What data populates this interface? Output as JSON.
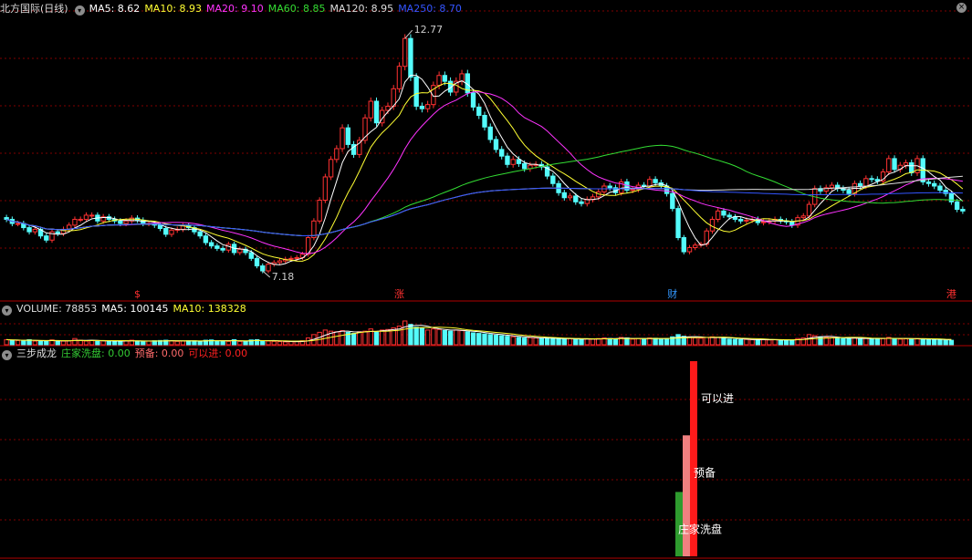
{
  "price_panel": {
    "title": "北方国际(日线)",
    "ma": [
      {
        "label": "MA5: 8.62",
        "color": "#ffffff"
      },
      {
        "label": "MA10: 8.93",
        "color": "#ffff33"
      },
      {
        "label": "MA20: 9.10",
        "color": "#ff33ff"
      },
      {
        "label": "MA60: 8.85",
        "color": "#33dd33"
      },
      {
        "label": "MA120: 8.95",
        "color": "#dddddd"
      },
      {
        "label": "MA250: 8.70",
        "color": "#3355ff"
      }
    ],
    "close_symbol": "×"
  },
  "volume_panel": {
    "title": "VOLUME: 78853",
    "ma": [
      {
        "label": "MA5: 100145",
        "color": "#ffffff"
      },
      {
        "label": "MA10: 138328",
        "color": "#ffff33"
      }
    ]
  },
  "indicator_panel": {
    "title": "三步成龙",
    "items": [
      {
        "label": "庄家洗盘: 0.00",
        "color": "#33cc33"
      },
      {
        "label": "预备: 0.00",
        "color": "#ff6b6b"
      },
      {
        "label": "可以进: 0.00",
        "color": "#ff2020"
      }
    ]
  },
  "colors": {
    "up": "#ff3232",
    "down": "#54fcfc",
    "grid": "#800000",
    "axis": "#b00000"
  },
  "chart_data": [
    {
      "type": "candlestick",
      "title": "北方国际(日线)",
      "ylim": [
        6.5,
        13.3
      ],
      "annotations": [
        {
          "label": "12.77",
          "index": 70,
          "value": 12.77
        },
        {
          "label": "7.18",
          "index": 45,
          "value": 7.18
        }
      ],
      "event_markers": [
        {
          "label": "$",
          "index": 23,
          "color": "#ff3030"
        },
        {
          "label": "涨",
          "index": 69,
          "color": "#ff3030"
        },
        {
          "label": "财",
          "index": 117,
          "color": "#3399ff"
        },
        {
          "label": "港",
          "index": 166,
          "color": "#ff3030"
        }
      ],
      "close": [
        8.42,
        8.32,
        8.32,
        8.22,
        8.12,
        8.18,
        8.02,
        7.92,
        8.12,
        8.08,
        8.18,
        8.28,
        8.42,
        8.42,
        8.52,
        8.52,
        8.38,
        8.48,
        8.42,
        8.38,
        8.32,
        8.38,
        8.45,
        8.4,
        8.32,
        8.32,
        8.28,
        8.2,
        8.06,
        8.16,
        8.18,
        8.26,
        8.22,
        8.12,
        8.02,
        7.86,
        7.78,
        7.72,
        7.68,
        7.82,
        7.62,
        7.7,
        7.62,
        7.48,
        7.3,
        7.18,
        7.34,
        7.38,
        7.42,
        7.46,
        7.48,
        7.5,
        7.58,
        7.98,
        8.38,
        8.88,
        9.44,
        9.86,
        10.12,
        10.62,
        10.22,
        9.98,
        10.32,
        10.86,
        11.26,
        10.74,
        11.04,
        11.14,
        11.56,
        12.1,
        12.77,
        11.84,
        11.14,
        11.08,
        11.18,
        11.64,
        11.88,
        11.74,
        11.48,
        11.74,
        11.92,
        11.46,
        11.12,
        10.92,
        10.64,
        10.34,
        10.1,
        9.94,
        9.74,
        9.86,
        9.76,
        9.64,
        9.72,
        9.74,
        9.68,
        9.46,
        9.28,
        9.06,
        8.94,
        8.98,
        8.84,
        8.8,
        8.9,
        8.96,
        9.08,
        9.22,
        9.18,
        9.06,
        9.32,
        9.12,
        9.14,
        9.24,
        9.22,
        9.38,
        9.3,
        9.22,
        9.04,
        8.68,
        7.98,
        7.64,
        7.74,
        7.8,
        7.82,
        8.14,
        8.42,
        8.62,
        8.52,
        8.48,
        8.42,
        8.38,
        8.4,
        8.42,
        8.34,
        8.36,
        8.38,
        8.42,
        8.38,
        8.36,
        8.28,
        8.46,
        8.5,
        8.78,
        9.16,
        9.1,
        9.18,
        9.24,
        9.16,
        9.12,
        9.04,
        9.28,
        9.22,
        9.4,
        9.38,
        9.34,
        9.56,
        9.88,
        9.62,
        9.72,
        9.78,
        9.54,
        9.88,
        9.32,
        9.28,
        9.22,
        9.12,
        9.04,
        8.84,
        8.66,
        8.62
      ]
    },
    {
      "type": "bar",
      "title": "VOLUME: 78853",
      "ylim": [
        0,
        500000
      ],
      "values": [
        90000,
        80000,
        75000,
        70000,
        90000,
        65000,
        60000,
        70000,
        85000,
        60000,
        65000,
        70000,
        110000,
        80000,
        65000,
        75000,
        60000,
        70000,
        65000,
        60000,
        65000,
        70000,
        80000,
        60000,
        55000,
        65000,
        70000,
        75000,
        80000,
        70000,
        60000,
        65000,
        70000,
        70000,
        60000,
        80000,
        85000,
        70000,
        65000,
        60000,
        90000,
        60000,
        55000,
        85000,
        90000,
        70000,
        65000,
        60000,
        55000,
        50000,
        55000,
        55000,
        70000,
        120000,
        180000,
        220000,
        260000,
        240000,
        230000,
        250000,
        220000,
        200000,
        230000,
        240000,
        280000,
        230000,
        260000,
        270000,
        300000,
        330000,
        420000,
        360000,
        310000,
        290000,
        260000,
        280000,
        270000,
        250000,
        240000,
        260000,
        250000,
        230000,
        210000,
        200000,
        190000,
        180000,
        170000,
        160000,
        150000,
        140000,
        130000,
        120000,
        125000,
        120000,
        110000,
        120000,
        110000,
        105000,
        100000,
        110000,
        100000,
        95000,
        105000,
        100000,
        110000,
        120000,
        110000,
        100000,
        130000,
        120000,
        100000,
        110000,
        100000,
        120000,
        115000,
        105000,
        110000,
        140000,
        180000,
        150000,
        130000,
        120000,
        115000,
        130000,
        140000,
        130000,
        115000,
        100000,
        95000,
        90000,
        95000,
        90000,
        85000,
        90000,
        85000,
        90000,
        80000,
        85000,
        80000,
        110000,
        120000,
        180000,
        160000,
        140000,
        130000,
        125000,
        120000,
        110000,
        105000,
        120000,
        110000,
        115000,
        110000,
        100000,
        115000,
        130000,
        110000,
        100000,
        105000,
        100000,
        110000,
        100000,
        95000,
        90000,
        85000,
        80000,
        78853
      ],
      "ma5_label": "MA5: 100145",
      "ma10_label": "MA10: 138328"
    },
    {
      "type": "bar",
      "title": "三步成龙",
      "ylim": [
        0,
        1
      ],
      "series": [
        {
          "name": "庄家洗盘",
          "index": 124,
          "value": 0.33,
          "color": "#2e9b2e"
        },
        {
          "name": "预备",
          "index": 125,
          "value": 0.62,
          "color": "#f08080"
        },
        {
          "name": "可以进",
          "index": 126,
          "value": 1.0,
          "color": "#ff1a1a"
        }
      ],
      "labels": [
        "庄家洗盘",
        "预备",
        "可以进"
      ]
    }
  ]
}
